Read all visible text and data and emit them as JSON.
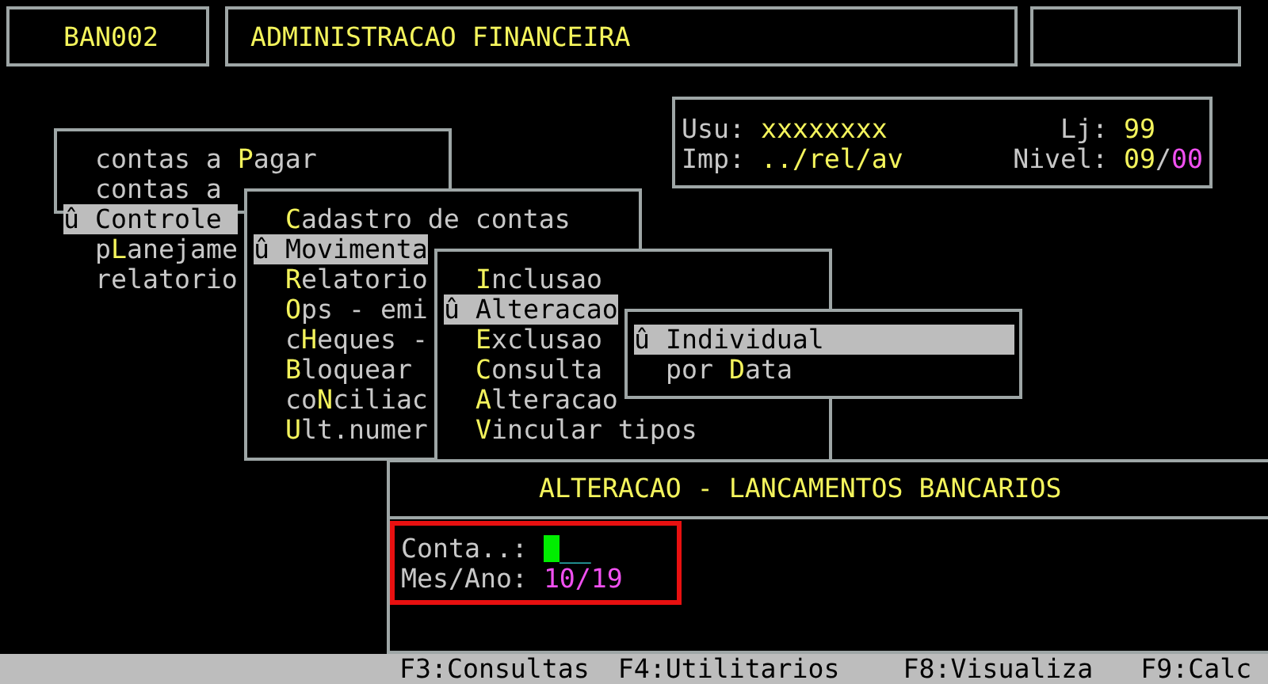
{
  "header": {
    "code": "BAN002",
    "title": "ADMINISTRACAO FINANCEIRA"
  },
  "user_info": {
    "user_label": "Usu:",
    "user": "xxxxxxxx",
    "store_label": "Lj:",
    "store": "99",
    "printer_label": "Imp:",
    "printer": "../rel/av",
    "level_label": "Nivel:",
    "level_a": "09",
    "level_sep": "/",
    "level_b": "00"
  },
  "menus": [
    {
      "marker": "û",
      "items": [
        {
          "pre": "contas a ",
          "key": "P",
          "post": "agar",
          "selected": false
        },
        {
          "pre": "contas a",
          "selected": false
        },
        {
          "pre": "Controle",
          "selected": true
        },
        {
          "pre": "p",
          "key": "L",
          "post": "anejame",
          "selected": false
        },
        {
          "pre": "relatorio",
          "selected": false
        }
      ]
    },
    {
      "marker": "û",
      "items": [
        {
          "key": "C",
          "post": "adastro de contas",
          "selected": false
        },
        {
          "pre": "Movimenta",
          "selected": true
        },
        {
          "key": "R",
          "post": "elatorio",
          "selected": false
        },
        {
          "key": "O",
          "post": "ps - emi",
          "selected": false
        },
        {
          "pre": "c",
          "key": "H",
          "post": "eques -",
          "selected": false
        },
        {
          "key": "B",
          "post": "loquear",
          "selected": false
        },
        {
          "pre": "co",
          "key": "N",
          "post": "ciliac",
          "selected": false
        },
        {
          "key": "U",
          "post": "lt.numer",
          "selected": false
        }
      ]
    },
    {
      "marker": "û",
      "items": [
        {
          "key": "I",
          "post": "nclusao",
          "selected": false
        },
        {
          "pre": "Alteracao",
          "selected": true
        },
        {
          "key": "E",
          "post": "xclusao",
          "selected": false
        },
        {
          "key": "C",
          "post": "onsulta",
          "selected": false
        },
        {
          "key": "A",
          "post": "lteracao",
          "selected": false
        },
        {
          "key": "V",
          "post": "incular tipos",
          "selected": false
        }
      ]
    },
    {
      "marker": "û",
      "items": [
        {
          "pre": "Individual",
          "selected": true
        },
        {
          "pre": "por ",
          "key": "D",
          "post": "ata",
          "selected": false
        }
      ]
    }
  ],
  "form": {
    "title": "ALTERACAO - LANCAMENTOS BANCARIOS",
    "highlighted": true,
    "fields": [
      {
        "kind": "entry",
        "label": "Conta..:",
        "value": "__",
        "focused": true
      },
      {
        "kind": "value",
        "label": "Mes/Ano:",
        "value": "10/19"
      }
    ]
  },
  "status_bar": [
    "F3:Consultas",
    "F4:Utilitarios",
    "F8:Visualiza",
    "F9:Calc"
  ]
}
